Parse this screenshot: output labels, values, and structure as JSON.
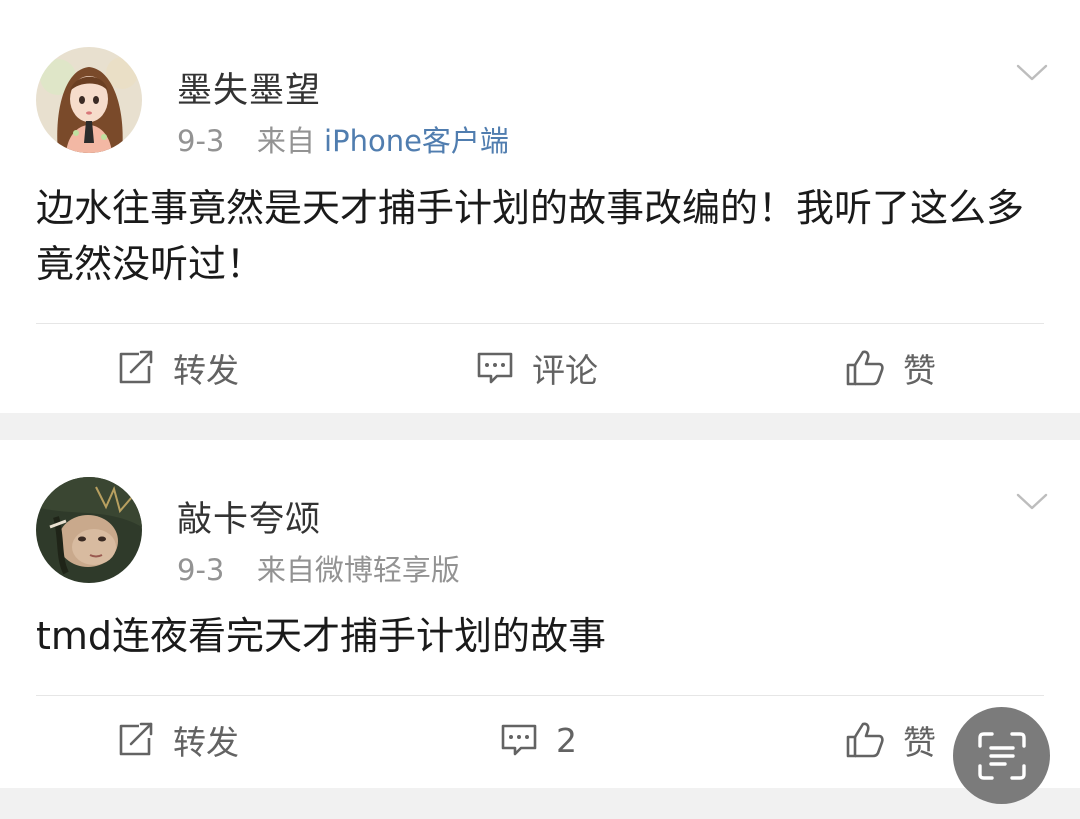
{
  "posts": [
    {
      "username": "墨失墨望",
      "date": "9-3",
      "source_prefix": "来自",
      "source": "iPhone客户端",
      "text": "边水往事竟然是天才捕手计划的故事改编的！我听了这么多竟然没听过！",
      "repost_label": "转发",
      "comment_label": "评论",
      "like_label": "赞",
      "avatar_icon": "avatar-girl-illustration"
    },
    {
      "username": "敲卡夸颂",
      "date": "9-3",
      "source_prefix": "来自",
      "source": "微博轻享版",
      "text": "tmd连夜看完天才捕手计划的故事",
      "repost_label": "转发",
      "comment_label": "2",
      "like_label": "赞",
      "avatar_icon": "avatar-photo"
    }
  ],
  "icons": {
    "repost": "repost-icon",
    "comment": "comment-icon",
    "like": "thumbs-up-icon",
    "more": "chevron-down-icon",
    "scan": "scan-text-icon"
  },
  "colors": {
    "background": "#f1f1f1",
    "card": "#ffffff",
    "username": "#333333",
    "meta": "#939393",
    "source_link": "#507daf",
    "action": "#636363",
    "fab": "#7b7b7b"
  }
}
